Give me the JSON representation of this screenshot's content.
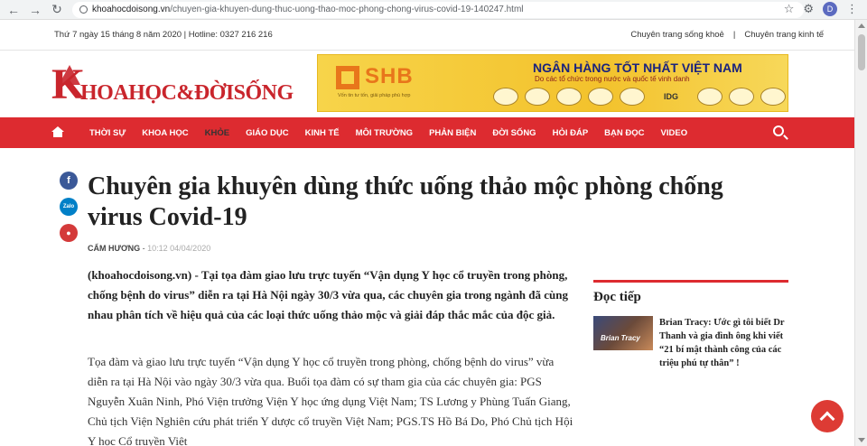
{
  "browser": {
    "url_domain": "khoahocdoisong.vn",
    "url_path": "/chuyen-gia-khuyen-dung-thuc-uong-thao-moc-phong-chong-virus-covid-19-140247.html",
    "back_icon": "←",
    "forward_icon": "→",
    "reload_icon": "↻",
    "star_icon": "☆",
    "puzzle_icon": "⚙",
    "avatar_letter": "D",
    "menu_icon": "⋮"
  },
  "topbar": {
    "date_hotline": "Thứ 7 ngày 15 tháng 8 năm 2020 | Hotline: 0327 216 216",
    "links": [
      "Chuyên trang sống khoẻ",
      "Chuyên trang kinh tế"
    ]
  },
  "header": {
    "logo_k": "K",
    "logo_text": "HOAHỌC&ĐỜISỐNG",
    "banner": {
      "brand": "SHB",
      "brand_sub": "Vốn tin tư tốn, giải pháp phù hợp",
      "title": "NGÂN HÀNG TỐT NHẤT VIỆT NAM",
      "subtitle": "Do các tổ chức trong nước và quốc tế vinh danh",
      "badges": [
        "",
        "",
        "",
        "",
        "",
        "IDG",
        "",
        "",
        ""
      ]
    }
  },
  "nav": {
    "items": [
      "THỜI SỰ",
      "KHOA HỌC",
      "KHỎE",
      "GIÁO DỤC",
      "KINH TẾ",
      "MÔI TRƯỜNG",
      "PHẢN BIỆN",
      "ĐỜI SỐNG",
      "HỎI ĐÁP",
      "BẠN ĐỌC",
      "VIDEO"
    ],
    "active_index": 2
  },
  "social": {
    "facebook": "f",
    "zalo": "Zalo",
    "comment": "●"
  },
  "article": {
    "title": "Chuyên gia khuyên dùng thức uống thảo mộc phòng chống virus Covid-19",
    "author": "CẨM HƯƠNG",
    "meta_sep": " - ",
    "time": "10:12 04/04/2020",
    "lead": "(khoahocdoisong.vn) - Tại tọa đàm giao lưu trực tuyến “Vận dụng Y học cổ truyền trong phòng, chống bệnh do virus” diễn ra tại Hà Nội ngày 30/3 vừa qua, các chuyên gia trong ngành đã cùng nhau phân tích về hiệu quả của các loại thức uống thảo mộc và giải đáp thắc mắc của độc giả.",
    "body": "Tọa đàm và giao lưu trực tuyến “Vận dụng Y học cổ truyền trong phòng, chống bệnh do virus” vừa diễn ra tại Hà Nội vào ngày 30/3 vừa qua. Buổi tọa đàm có sự tham gia của các chuyên gia: PGS Nguyễn Xuân Ninh, Phó Viện trưởng Viện Y học ứng dụng Việt Nam; TS Lương y Phùng Tuấn Giang, Chủ tịch Viện Nghiên cứu phát triển Y dược cổ truyền Việt Nam; PGS.TS Hồ Bá Do, Phó Chủ tịch Hội Y học Cổ truyền Việt"
  },
  "sidebar": {
    "heading": "Đọc tiếp",
    "related": {
      "thumb_label": "Brian Tracy",
      "text": "Brian Tracy: Ước gì tôi biết Dr Thanh và gia đình ông khi viết  “21 bí mật thành công của các triệu phú tự thân” !"
    }
  }
}
